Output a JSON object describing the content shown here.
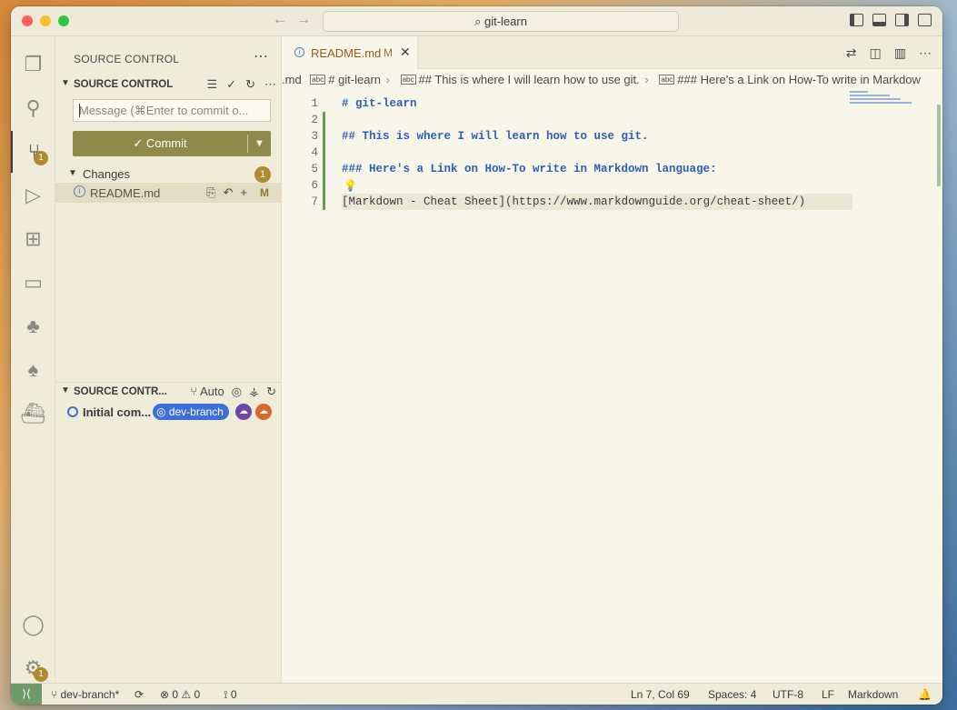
{
  "titlebar": {
    "search": "git-learn"
  },
  "activity": {
    "scm_badge": "1",
    "settings_badge": "1"
  },
  "sidebar": {
    "title": "SOURCE CONTROL",
    "scm_section": "SOURCE CONTROL",
    "commit_placeholder": "Message (⌘Enter to commit o...",
    "commit_label": "Commit",
    "changes_label": "Changes",
    "changes_count": "1",
    "file": {
      "name": "README.md",
      "status": "M"
    },
    "graph_section": "SOURCE CONTR...",
    "graph_mode": "Auto",
    "graph_commit": "Initial com...",
    "graph_branch": "dev-branch"
  },
  "editor": {
    "tab": {
      "name": "README.md",
      "status": "M"
    },
    "breadcrumb": [
      ".md",
      "# git-learn",
      "## This is where I will learn how to use git.",
      "### Here's a Link on How-To write in Markdow"
    ],
    "lines": [
      {
        "n": "1",
        "text": "# git-learn"
      },
      {
        "n": "2",
        "text": ""
      },
      {
        "n": "3",
        "text": "## This is where I will learn how to use git."
      },
      {
        "n": "4",
        "text": ""
      },
      {
        "n": "5",
        "text": "### Here's a Link on How-To write in Markdown language:"
      },
      {
        "n": "6",
        "text": ""
      },
      {
        "n": "7",
        "link_text": "[Markdown - Cheat Sheet]",
        "link_paren_open": "(",
        "link_url": "https://www.markdownguide.org/cheat-sheet/",
        "link_paren_close": ")"
      }
    ]
  },
  "status": {
    "branch": "dev-branch*",
    "errors": "0",
    "warnings": "0",
    "ports": "0",
    "position": "Ln 7, Col 69",
    "spaces": "Spaces: 4",
    "encoding": "UTF-8",
    "eol": "LF",
    "language": "Markdown"
  }
}
